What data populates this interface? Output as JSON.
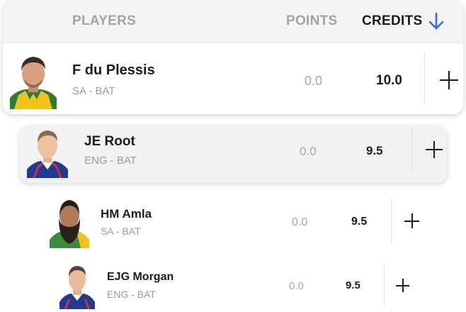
{
  "header": {
    "players_label": "PLAYERS",
    "points_label": "POINTS",
    "credits_label": "CREDITS",
    "sort_icon": "arrow-down-icon",
    "accent_color": "#2f6fe8"
  },
  "players": [
    {
      "name": "F du Plessis",
      "team_role": "SA - BAT",
      "points": "0.0",
      "credits": "10.0",
      "add_icon": "plus-icon"
    },
    {
      "name": "JE Root",
      "team_role": "ENG - BAT",
      "points": "0.0",
      "credits": "9.5",
      "add_icon": "plus-icon"
    },
    {
      "name": "HM Amla",
      "team_role": "SA - BAT",
      "points": "0.0",
      "credits": "9.5",
      "add_icon": "plus-icon"
    },
    {
      "name": "EJG Morgan",
      "team_role": "ENG - BAT",
      "points": "0.0",
      "credits": "9.5",
      "add_icon": "plus-icon"
    }
  ]
}
